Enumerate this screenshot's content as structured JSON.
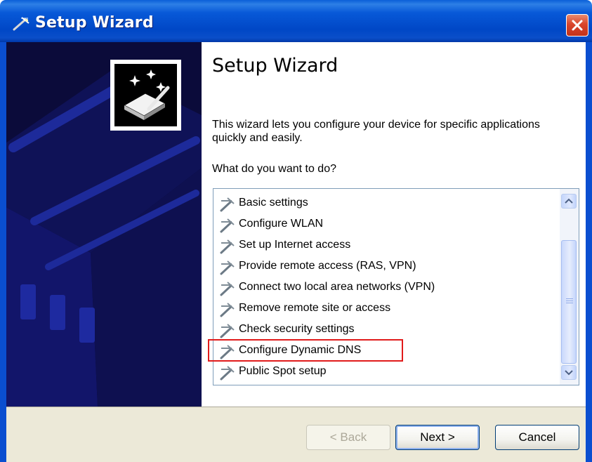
{
  "window": {
    "title": "Setup Wizard"
  },
  "main": {
    "heading": "Setup Wizard",
    "description": "This wizard lets you configure your device for specific applications quickly and easily.",
    "question": "What do you want to do?"
  },
  "options": [
    {
      "label": "Basic settings"
    },
    {
      "label": "Configure WLAN"
    },
    {
      "label": "Set up Internet access"
    },
    {
      "label": "Provide remote access (RAS, VPN)"
    },
    {
      "label": "Connect two local area networks (VPN)"
    },
    {
      "label": "Remove remote site or access"
    },
    {
      "label": "Check security settings"
    },
    {
      "label": "Configure Dynamic DNS"
    },
    {
      "label": "Public Spot setup"
    }
  ],
  "highlighted_option": "Configure Dynamic DNS",
  "buttons": {
    "back": "< Back",
    "next": "Next >",
    "cancel": "Cancel"
  },
  "colors": {
    "titlebar": "#0047c6",
    "side_panel": "#0b0b3a",
    "highlight_border": "#e11b1b",
    "footer": "#ece9d8"
  },
  "icons": {
    "title": "magic-wand-icon",
    "option": "wand-icon",
    "close": "close-icon",
    "wizard": "wizard-device-icon"
  }
}
